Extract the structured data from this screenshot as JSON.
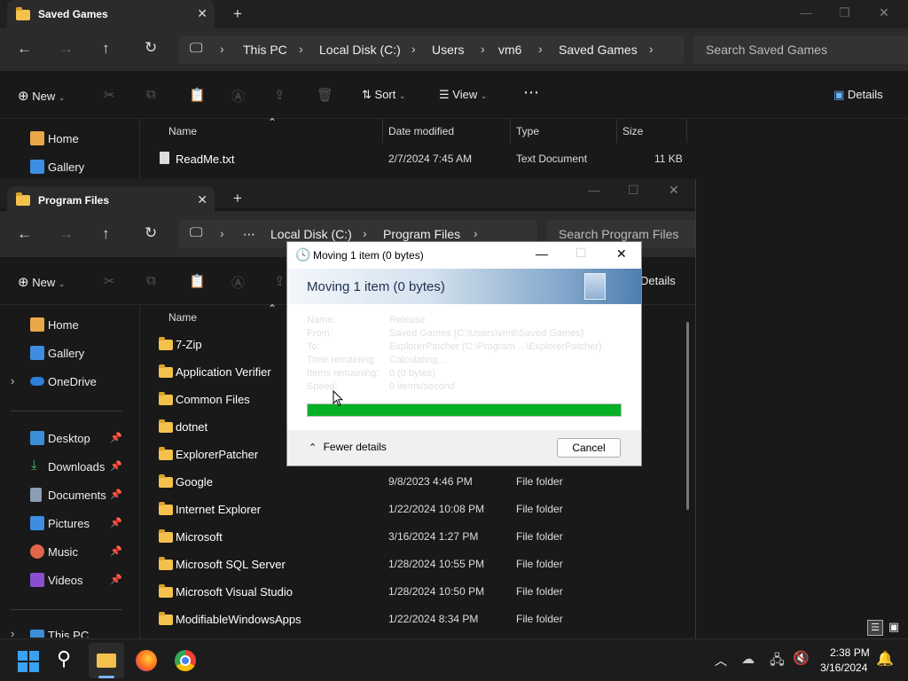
{
  "back_window": {
    "tab_title": "Saved Games",
    "new_tab": "+",
    "breadcrumbs": [
      "This PC",
      "Local Disk (C:)",
      "Users",
      "vm6",
      "Saved Games"
    ],
    "search_placeholder": "Search Saved Games",
    "new_label": "New",
    "sort_label": "Sort",
    "view_label": "View",
    "details_label": "Details",
    "nav": [
      "Home",
      "Gallery"
    ],
    "columns": [
      "Name",
      "Date modified",
      "Type",
      "Size"
    ],
    "files": [
      {
        "name": "ReadMe.txt",
        "date": "2/7/2024 7:45 AM",
        "type": "Text Document",
        "size": "11 KB"
      }
    ]
  },
  "front_window": {
    "tab_title": "Program Files",
    "new_tab": "+",
    "breadcrumbs": [
      "Local Disk (C:)",
      "Program Files"
    ],
    "search_placeholder": "Search Program Files",
    "new_label": "New",
    "details_label": "Details",
    "nav": [
      "Home",
      "Gallery",
      "OneDrive",
      "Desktop",
      "Downloads",
      "Documents",
      "Pictures",
      "Music",
      "Videos",
      "This PC"
    ],
    "columns": [
      "Name"
    ],
    "files": [
      {
        "name": "7-Zip",
        "date": "",
        "type": ""
      },
      {
        "name": "Application Verifier",
        "date": "",
        "type": ""
      },
      {
        "name": "Common Files",
        "date": "",
        "type": ""
      },
      {
        "name": "dotnet",
        "date": "",
        "type": ""
      },
      {
        "name": "ExplorerPatcher",
        "date": "",
        "type": ""
      },
      {
        "name": "Google",
        "date": "9/8/2023 4:46 PM",
        "type": "File folder"
      },
      {
        "name": "Internet Explorer",
        "date": "1/22/2024 10:08 PM",
        "type": "File folder"
      },
      {
        "name": "Microsoft",
        "date": "3/16/2024 1:27 PM",
        "type": "File folder"
      },
      {
        "name": "Microsoft SQL Server",
        "date": "1/28/2024 10:55 PM",
        "type": "File folder"
      },
      {
        "name": "Microsoft Visual Studio",
        "date": "1/28/2024 10:50 PM",
        "type": "File folder"
      },
      {
        "name": "ModifiableWindowsApps",
        "date": "1/22/2024 8:34 PM",
        "type": "File folder"
      }
    ]
  },
  "dialog": {
    "title": "Moving 1 item (0 bytes)",
    "heading": "Moving 1 item (0 bytes)",
    "rows": [
      {
        "label": "Name:",
        "value": "Release"
      },
      {
        "label": "From:",
        "value": "Saved Games (C:\\Users\\vm6\\Saved Games)"
      },
      {
        "label": "To:",
        "value": "ExplorerPatcher (C:\\Program ...\\ExplorerPatcher)"
      },
      {
        "label": "Time remaining:",
        "value": "Calculating..."
      },
      {
        "label": "Items remaining:",
        "value": "0 (0 bytes)"
      },
      {
        "label": "Speed:",
        "value": "0 items/second"
      }
    ],
    "progress": 1.0,
    "fewer_details": "Fewer details",
    "cancel": "Cancel"
  },
  "taskbar": {
    "time": "2:38 PM",
    "date": "3/16/2024"
  },
  "colors": {
    "progress": "#06b025",
    "folder": "#f5c14d"
  }
}
